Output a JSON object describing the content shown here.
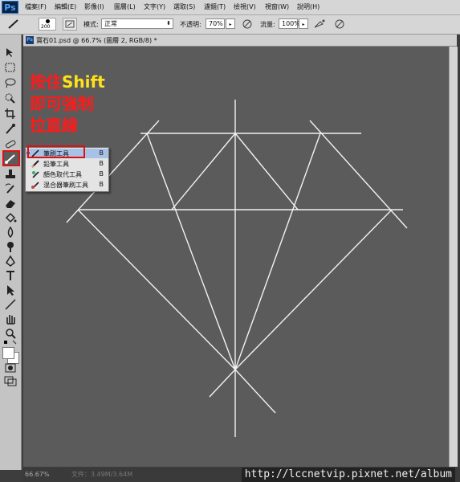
{
  "app": {
    "logo": "Ps"
  },
  "menubar": {
    "items": [
      "檔案(F)",
      "編輯(E)",
      "影像(I)",
      "圖層(L)",
      "文字(Y)",
      "選取(S)",
      "濾鏡(T)",
      "檢視(V)",
      "視窗(W)",
      "說明(H)"
    ]
  },
  "options_bar": {
    "brush_size": "200",
    "mode_label": "模式:",
    "mode_value": "正常",
    "opacity_label": "不透明:",
    "opacity_value": "70%",
    "flow_label": "流量:",
    "flow_value": "100%"
  },
  "document": {
    "tab_title": "寶石01.psd @ 66.7% (圖層 2, RGB/8) *",
    "tab_icon": "Ps"
  },
  "annotation": {
    "line1_a": "按住",
    "line1_b": "Shift",
    "line2": "即可強制",
    "line3": "拉直線",
    "color_red": "#ff1a1a",
    "color_yellow": "#ffe21a"
  },
  "flyout": {
    "items": [
      {
        "label": "筆刷工具",
        "key": "B",
        "icon": "brush-icon",
        "selected": true
      },
      {
        "label": "鉛筆工具",
        "key": "B",
        "icon": "pencil-icon",
        "selected": false
      },
      {
        "label": "顏色取代工具",
        "key": "B",
        "icon": "color-replace-icon",
        "selected": false
      },
      {
        "label": "混合器筆刷工具",
        "key": "B",
        "icon": "mixer-brush-icon",
        "selected": false
      }
    ]
  },
  "statusbar": {
    "zoom": "66.67%",
    "doc_size": "文件：3.49M/3.64M"
  },
  "watermark": "http://lccnetvip.pixnet.net/album",
  "colors": {
    "canvas": "#5b5b5b",
    "highlight": "#e01010",
    "selection": "#a8c2e6"
  }
}
